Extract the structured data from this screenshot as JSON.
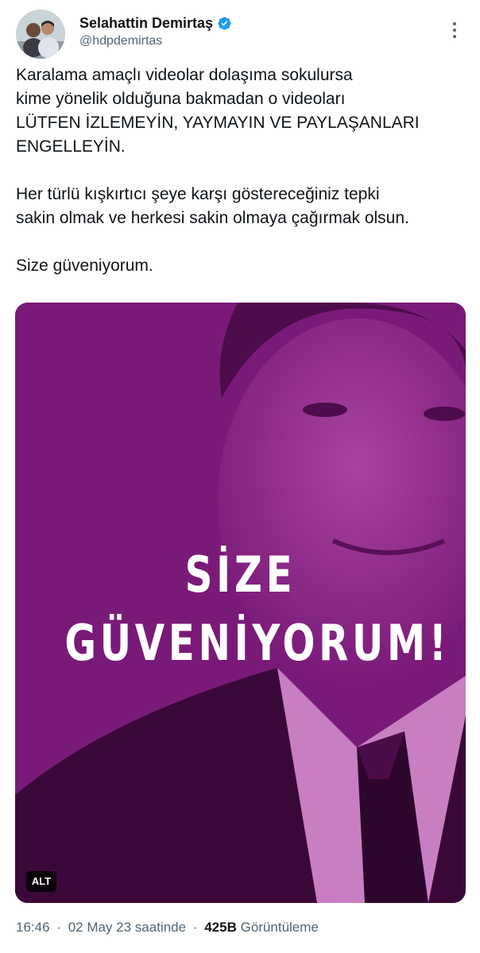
{
  "author": {
    "display_name": "Selahattin Demirtaş",
    "handle": "@hdpdemirtas",
    "verified_icon": "verified-badge-icon",
    "verified_color": "#1d9bf0"
  },
  "tweet": {
    "paragraphs": [
      "Karalama amaçlı videolar dolaşıma sokulursa\nkime yönelik olduğuna bakmadan o videoları\nLÜTFEN İZLEMEYİN, YAYMAYIN VE PAYLAŞANLARI\nENGELLEYİN.",
      "Her türlü kışkırtıcı şeye karşı göstereceğiniz tepki\nsakin olmak ve herkesi sakin olmaya çağırmak olsun.",
      "Size güveniyorum."
    ]
  },
  "media": {
    "line1": "SİZE",
    "line2": "GÜVENİYORUM!",
    "alt_label": "ALT",
    "tint_color": "#7a1a78"
  },
  "meta": {
    "time": "16:46",
    "date_text": "02 May 23 saatinde",
    "separator": "·",
    "views_count": "425B",
    "views_label": "Görüntüleme"
  }
}
